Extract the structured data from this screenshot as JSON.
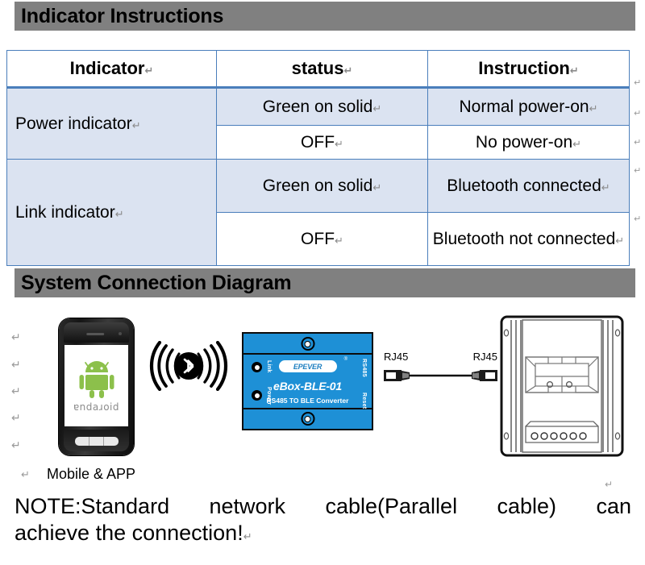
{
  "sections": {
    "indicator": {
      "title": "Indicator Instructions"
    },
    "system": {
      "title": "System Connection Diagram"
    }
  },
  "indicator_table": {
    "headers": [
      "Indicator",
      "status",
      "Instruction"
    ],
    "rows": [
      {
        "indicator": "Power indicator",
        "entries": [
          {
            "status": "Green on solid",
            "instruction": "Normal power-on",
            "shaded": true
          },
          {
            "status": "OFF",
            "instruction": "No power-on",
            "shaded": false
          }
        ]
      },
      {
        "indicator": "Link indicator",
        "entries": [
          {
            "status": "Green on solid",
            "instruction": "Bluetooth connected",
            "shaded": true
          },
          {
            "status": "OFF",
            "instruction": "Bluetooth not connected",
            "shaded": false
          }
        ]
      }
    ],
    "paragraph_mark": "↵"
  },
  "diagram": {
    "phone": {
      "screen_logo": "android-robot-icon",
      "screen_word": "ɐndaɹoid",
      "caption": "Mobile & APP"
    },
    "wireless": {
      "icon": "bluetooth-wireless-icon"
    },
    "converter": {
      "brand": "EPEVER",
      "trademark": "®",
      "model": "eBox-BLE-01",
      "subtitle": "RS485 TO BLE Converter",
      "led_link_label": "Link",
      "led_power_label": "Power",
      "port_rs485_label": "RS485",
      "button_reset_label": "Reset"
    },
    "cable": {
      "left_label": "RJ45",
      "right_label": "RJ45"
    },
    "controller": {
      "icon": "solar-charge-controller-icon"
    },
    "margin_marks": [
      "↵",
      "↵",
      "↵",
      "↵",
      "↵"
    ]
  },
  "note": {
    "line1": "NOTE:Standard   network   cable(Parallel   cable)   can",
    "line2": "achieve the connection!",
    "paragraph_mark": "↵"
  },
  "colors": {
    "heading_bar": "#808080",
    "table_border": "#4a7ebb",
    "table_shaded_row": "#dbe3f1",
    "converter_body": "#1e90d6",
    "android_green": "#8cc04b",
    "epever_blue": "#1e7fc0"
  }
}
